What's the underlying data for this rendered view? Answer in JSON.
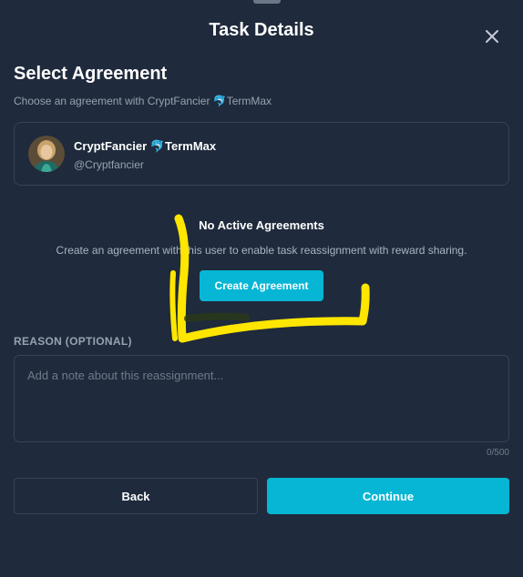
{
  "modal": {
    "title": "Task Details"
  },
  "agreement": {
    "title": "Select Agreement",
    "subtitle": "Choose an agreement with CryptFancier 🐬TermMax"
  },
  "user": {
    "name": "CryptFancier 🐬TermMax",
    "handle": "@Cryptfancier"
  },
  "empty_state": {
    "title": "No Active Agreements",
    "description": "Create an agreement with this user to enable task reassignment with reward sharing.",
    "button_label": "Create Agreement"
  },
  "reason": {
    "label": "REASON (OPTIONAL)",
    "placeholder": "Add a note about this reassignment...",
    "char_count": "0/500"
  },
  "actions": {
    "back_label": "Back",
    "continue_label": "Continue"
  },
  "colors": {
    "background": "#1f2a3c",
    "accent": "#06b6d4",
    "annotation": "#ffe600"
  },
  "icons": [
    "close-icon",
    "avatar"
  ]
}
